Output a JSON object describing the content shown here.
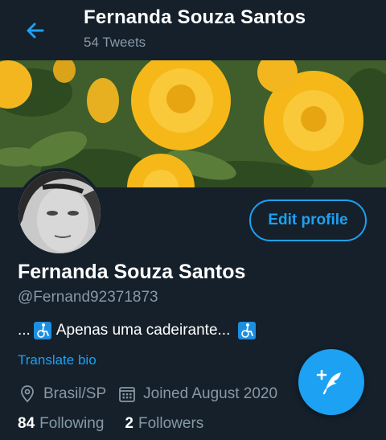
{
  "header": {
    "title": "Fernanda Souza Santos",
    "subtitle": "54 Tweets"
  },
  "profile": {
    "edit_label": "Edit profile",
    "name": "Fernanda Souza Santos",
    "handle": "@Fernand92371873",
    "bio_prefix": "...",
    "bio_text": "Apenas uma cadeirante...",
    "translate_label": "Translate bio",
    "location": "Brasil/SP",
    "joined": "Joined August 2020"
  },
  "stats": {
    "following_count": "84",
    "following_label": "Following",
    "followers_count": "2",
    "followers_label": "Followers"
  },
  "icons": {
    "back": "arrow-left-icon",
    "location": "location-pin-icon",
    "calendar": "calendar-icon",
    "wheelchair": "wheelchair-icon",
    "compose": "compose-feather-icon"
  },
  "colors": {
    "background": "#15202b",
    "accent": "#1da1f2",
    "secondary_text": "#8899a6"
  }
}
